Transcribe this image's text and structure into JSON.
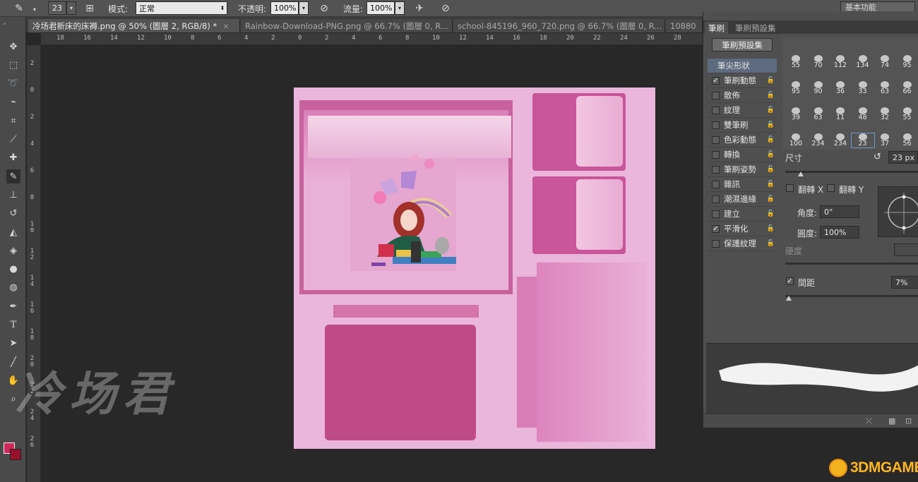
{
  "options_bar": {
    "brush_size": "23",
    "mode_label": "模式:",
    "mode_value": "正常",
    "opacity_label": "不透明:",
    "opacity_value": "100%",
    "flow_label": "流量:",
    "flow_value": "100%",
    "workspace": "基本功能"
  },
  "tabs": [
    {
      "label": "冷场君新床的床褥.png @ 50% (圖層 2, RGB/8) *",
      "close": "×"
    },
    {
      "label": "Rainbow-Download-PNG.png @ 66.7% (圖層 0, R...",
      "close": "×"
    },
    {
      "label": "school-845196_960_720.png @ 66.7% (圖層 0, R...",
      "close": "×"
    },
    {
      "label": "10880",
      "close": ""
    }
  ],
  "ruler_top": [
    "18",
    "16",
    "14",
    "12",
    "10",
    "8",
    "6",
    "4",
    "2",
    "0",
    "2",
    "4",
    "6",
    "8",
    "10",
    "12",
    "14",
    "16",
    "18",
    "20",
    "22",
    "24",
    "26",
    "28"
  ],
  "ruler_left": [
    "2",
    "0",
    "2",
    "4",
    "6",
    "8",
    "1\n0",
    "1\n2",
    "1\n4",
    "1\n6",
    "1\n8",
    "2\n0",
    "2\n2",
    "2\n4",
    "2\n6"
  ],
  "tools": [
    "move-icon",
    "marquee-icon",
    "lasso-icon",
    "quick-select-icon",
    "crop-icon",
    "eyedropper-icon",
    "healing-icon",
    "brush-icon",
    "stamp-icon",
    "history-brush-icon",
    "eraser-icon",
    "bucket-icon",
    "blur-icon",
    "dodge-icon",
    "pen-icon",
    "type-icon",
    "path-select-icon",
    "line-icon",
    "hand-icon",
    "zoom-icon"
  ],
  "type_tool_glyph": "T",
  "colors": {
    "foreground": "#d2265a",
    "background": "#97102c",
    "canvas": "#eab6db"
  },
  "panel": {
    "tabs": [
      "筆刷",
      "筆刷預設集"
    ],
    "preset_button": "筆刷預設集",
    "options": [
      {
        "label": "筆尖形狀",
        "header": true,
        "checked": false
      },
      {
        "label": "筆刷動態",
        "checked": true
      },
      {
        "label": "散佈",
        "checked": false
      },
      {
        "label": "紋理",
        "checked": false
      },
      {
        "label": "雙筆刷",
        "checked": false
      },
      {
        "label": "色彩動態",
        "checked": false
      },
      {
        "label": "轉換",
        "checked": false
      },
      {
        "label": "筆刷姿勢",
        "checked": false
      },
      {
        "label": "雜訊",
        "checked": false
      },
      {
        "label": "潮濕邊緣",
        "checked": false
      },
      {
        "label": "建立",
        "checked": false
      },
      {
        "label": "平滑化",
        "checked": true
      },
      {
        "label": "保護紋理",
        "checked": false
      }
    ],
    "brush_sizes": [
      [
        "55",
        "70",
        "112",
        "134",
        "74",
        "95"
      ],
      [
        "95",
        "90",
        "36",
        "33",
        "63",
        "66"
      ],
      [
        "39",
        "63",
        "11",
        "48",
        "32",
        "55"
      ],
      [
        "100",
        "234",
        "234",
        "23",
        "37",
        "56"
      ]
    ],
    "size_label": "尺寸",
    "size_value": "23 px",
    "flip_x": "翻轉 X",
    "flip_y": "翻轉 Y",
    "angle_label": "角度:",
    "angle_value": "0°",
    "roundness_label": "圓度:",
    "roundness_value": "100%",
    "hardness_label": "硬度",
    "spacing_label": "間距",
    "spacing_value": "7%"
  },
  "watermark_text": "冷场君",
  "logo_text": "3DMGAME"
}
